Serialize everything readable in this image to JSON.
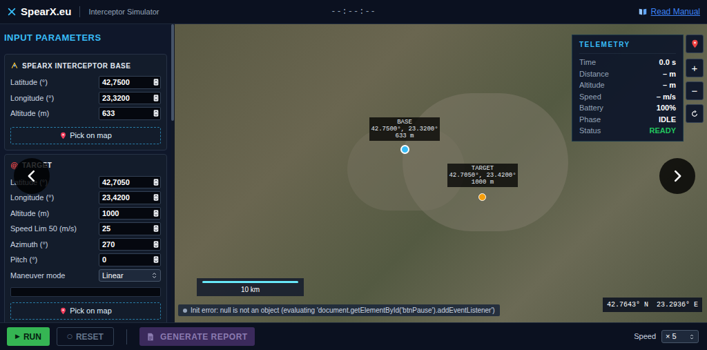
{
  "header": {
    "brand": "SpearX.eu",
    "subtitle": "Interceptor Simulator",
    "clock": "--:--:--",
    "manual": "Read Manual"
  },
  "sidebar": {
    "title": "INPUT PARAMETERS",
    "sections": [
      {
        "title": "SPEARX INTERCEPTOR BASE",
        "fields": [
          {
            "label": "Latitude (°)",
            "value": "42,7500",
            "kind": "number"
          },
          {
            "label": "Longitude (°)",
            "value": "23,3200",
            "kind": "number"
          },
          {
            "label": "Altitude (m)",
            "value": "633",
            "kind": "number"
          }
        ],
        "pick": "Pick on map"
      },
      {
        "title": "TARGET",
        "fields": [
          {
            "label": "Latitude (°)",
            "value": "42,7050",
            "kind": "number"
          },
          {
            "label": "Longitude (°)",
            "value": "23,4200",
            "kind": "number"
          },
          {
            "label": "Altitude (m)",
            "value": "1000",
            "kind": "number"
          },
          {
            "label": "Speed Lim 50 (m/s)",
            "value": "25",
            "kind": "number"
          },
          {
            "label": "Azimuth (°)",
            "value": "270",
            "kind": "number"
          },
          {
            "label": "Pitch (°)",
            "value": "0",
            "kind": "number"
          },
          {
            "label": "Maneuver mode",
            "value": "Linear",
            "kind": "select"
          }
        ],
        "pick": "Pick on map"
      }
    ]
  },
  "map": {
    "markers": [
      {
        "title": "BASE",
        "coords": "42.7500°, 23.3200°",
        "altitude": "633 m",
        "color": "#38bdf8"
      },
      {
        "title": "TARGET",
        "coords": "42.7050°, 23.4200°",
        "altitude": "1000 m",
        "color": "#f59e0b"
      }
    ],
    "scale": "10 km",
    "error": "Init error: null is not an object (evaluating 'document.getElementById('btnPause').addEventListener')",
    "cursor": {
      "lat": "42.7643° N",
      "lon": "23.2936° E"
    },
    "controls": {
      "zoom_in": "+",
      "zoom_out": "−"
    }
  },
  "telemetry": {
    "title": "TELEMETRY",
    "rows": [
      {
        "label": "Time",
        "value": "0.0 s",
        "color": "#ffffff"
      },
      {
        "label": "Distance",
        "value": "– m",
        "color": "#ffffff"
      },
      {
        "label": "Altitude",
        "value": "– m",
        "color": "#ffffff"
      },
      {
        "label": "Speed",
        "value": "– m/s",
        "color": "#ffffff"
      },
      {
        "label": "Battery",
        "value": "100%",
        "color": "#ffffff"
      },
      {
        "label": "Phase",
        "value": "IDLE",
        "color": "#ffffff"
      },
      {
        "label": "Status",
        "value": "READY",
        "color": "#22c55e"
      }
    ]
  },
  "toolbar": {
    "run": {
      "icon": "▶",
      "label": "RUN",
      "disabled": false
    },
    "reset": {
      "icon": "○",
      "label": "RESET",
      "disabled": true
    },
    "report": {
      "label": "GENERATE REPORT",
      "disabled": true
    },
    "speed": {
      "label": "Speed",
      "value": "× 5"
    }
  }
}
